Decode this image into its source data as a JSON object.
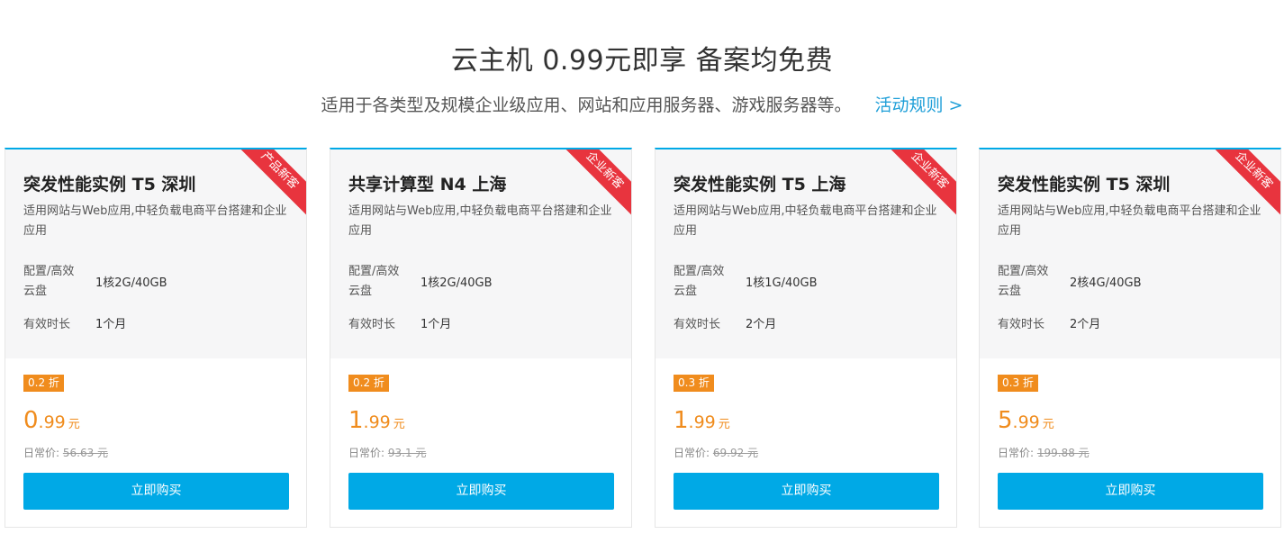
{
  "header": {
    "title": "云主机 0.99元即享 备案均免费",
    "subtitle": "适用于各类型及规模企业级应用、网站和应用服务器、游戏服务器等。",
    "rules_link": "活动规则 >"
  },
  "cards": [
    {
      "ribbon": "产品新客",
      "title": "突发性能实例 T5 深圳",
      "desc": "适用网站与Web应用,中轻负载电商平台搭建和企业应用",
      "spec_label": "配置/高效云盘",
      "spec_value": "1核2G/40GB",
      "duration_label": "有效时长",
      "duration_value": "1个月",
      "discount": "0.2 折",
      "price_int": "0",
      "price_dec": ".99",
      "price_unit": "元",
      "regular_label": "日常价:",
      "regular_price": "56.63 元",
      "buy": "立即购买"
    },
    {
      "ribbon": "企业新客",
      "title": "共享计算型 N4 上海",
      "desc": "适用网站与Web应用,中轻负载电商平台搭建和企业应用",
      "spec_label": "配置/高效云盘",
      "spec_value": "1核2G/40GB",
      "duration_label": "有效时长",
      "duration_value": "1个月",
      "discount": "0.2 折",
      "price_int": "1",
      "price_dec": ".99",
      "price_unit": "元",
      "regular_label": "日常价:",
      "regular_price": "93.1 元",
      "buy": "立即购买"
    },
    {
      "ribbon": "企业新客",
      "title": "突发性能实例 T5 上海",
      "desc": "适用网站与Web应用,中轻负载电商平台搭建和企业应用",
      "spec_label": "配置/高效云盘",
      "spec_value": "1核1G/40GB",
      "duration_label": "有效时长",
      "duration_value": "2个月",
      "discount": "0.3 折",
      "price_int": "1",
      "price_dec": ".99",
      "price_unit": "元",
      "regular_label": "日常价:",
      "regular_price": "69.92 元",
      "buy": "立即购买"
    },
    {
      "ribbon": "企业新客",
      "title": "突发性能实例 T5 深圳",
      "desc": "适用网站与Web应用,中轻负载电商平台搭建和企业应用",
      "spec_label": "配置/高效云盘",
      "spec_value": "2核4G/40GB",
      "duration_label": "有效时长",
      "duration_value": "2个月",
      "discount": "0.3 折",
      "price_int": "5",
      "price_dec": ".99",
      "price_unit": "元",
      "regular_label": "日常价:",
      "regular_price": "199.88 元",
      "buy": "立即购买"
    }
  ],
  "colors": {
    "accent": "#00a9e6",
    "link": "#1f9fd8",
    "price": "#f08c1d",
    "ribbon": "#e8343e"
  }
}
